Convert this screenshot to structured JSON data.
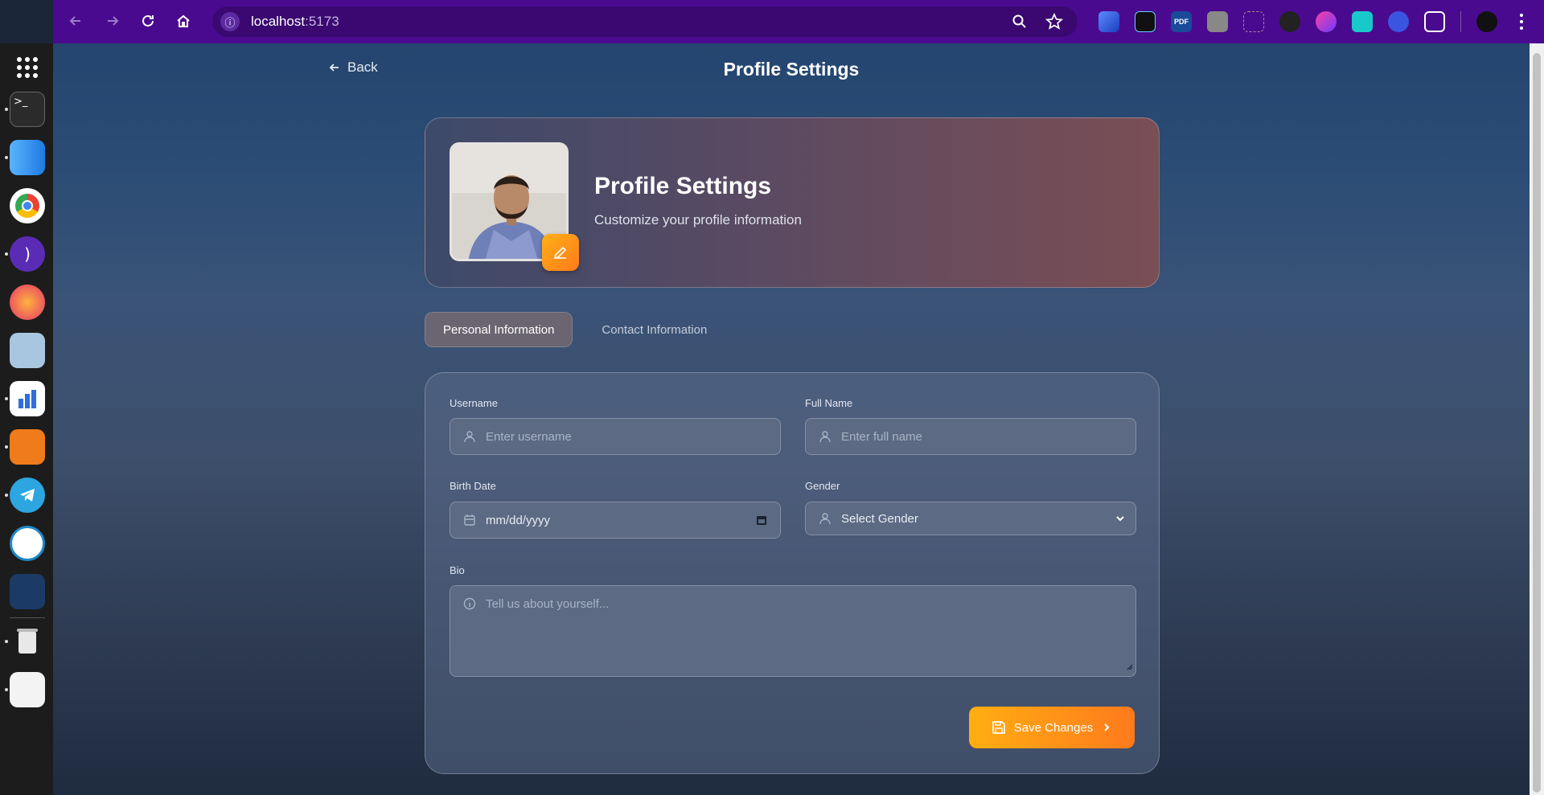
{
  "browser": {
    "url_host": "localhost",
    "url_port": ":5173",
    "extensions": [
      "pencil-ext-icon",
      "gamepad-ext-icon",
      "pdf-ext-icon",
      "camera-ext-icon",
      "capture-ext-icon",
      "feather-ext-icon",
      "ai-ext-icon",
      "bracket-ext-icon",
      "bot-ext-icon",
      "puzzle-icon"
    ]
  },
  "dock": {
    "apps": [
      "apps-grid-icon",
      "terminal-icon",
      "finder-icon",
      "chrome-icon",
      "podcast-icon",
      "firefox-icon",
      "anime-avatar-icon",
      "charts-icon",
      "vlc-icon",
      "telegram-icon",
      "remote-icon",
      "steam-icon",
      "trash-icon",
      "text-editor-icon"
    ]
  },
  "header": {
    "back_label": "Back",
    "title": "Profile Settings"
  },
  "hero": {
    "title": "Profile Settings",
    "subtitle": "Customize your profile information"
  },
  "tabs": [
    {
      "label": "Personal Information",
      "active": true
    },
    {
      "label": "Contact Information",
      "active": false
    }
  ],
  "form": {
    "username": {
      "label": "Username",
      "placeholder": "Enter username",
      "value": ""
    },
    "full_name": {
      "label": "Full Name",
      "placeholder": "Enter full name",
      "value": ""
    },
    "birth_date": {
      "label": "Birth Date",
      "value": "mm/dd/yyyy"
    },
    "gender": {
      "label": "Gender",
      "value": "Select Gender"
    },
    "bio": {
      "label": "Bio",
      "placeholder": "Tell us about yourself..."
    },
    "save_label": "Save Changes"
  },
  "colors": {
    "browser_bar": "#4a0a8f",
    "accent": "#ff9a1a"
  }
}
